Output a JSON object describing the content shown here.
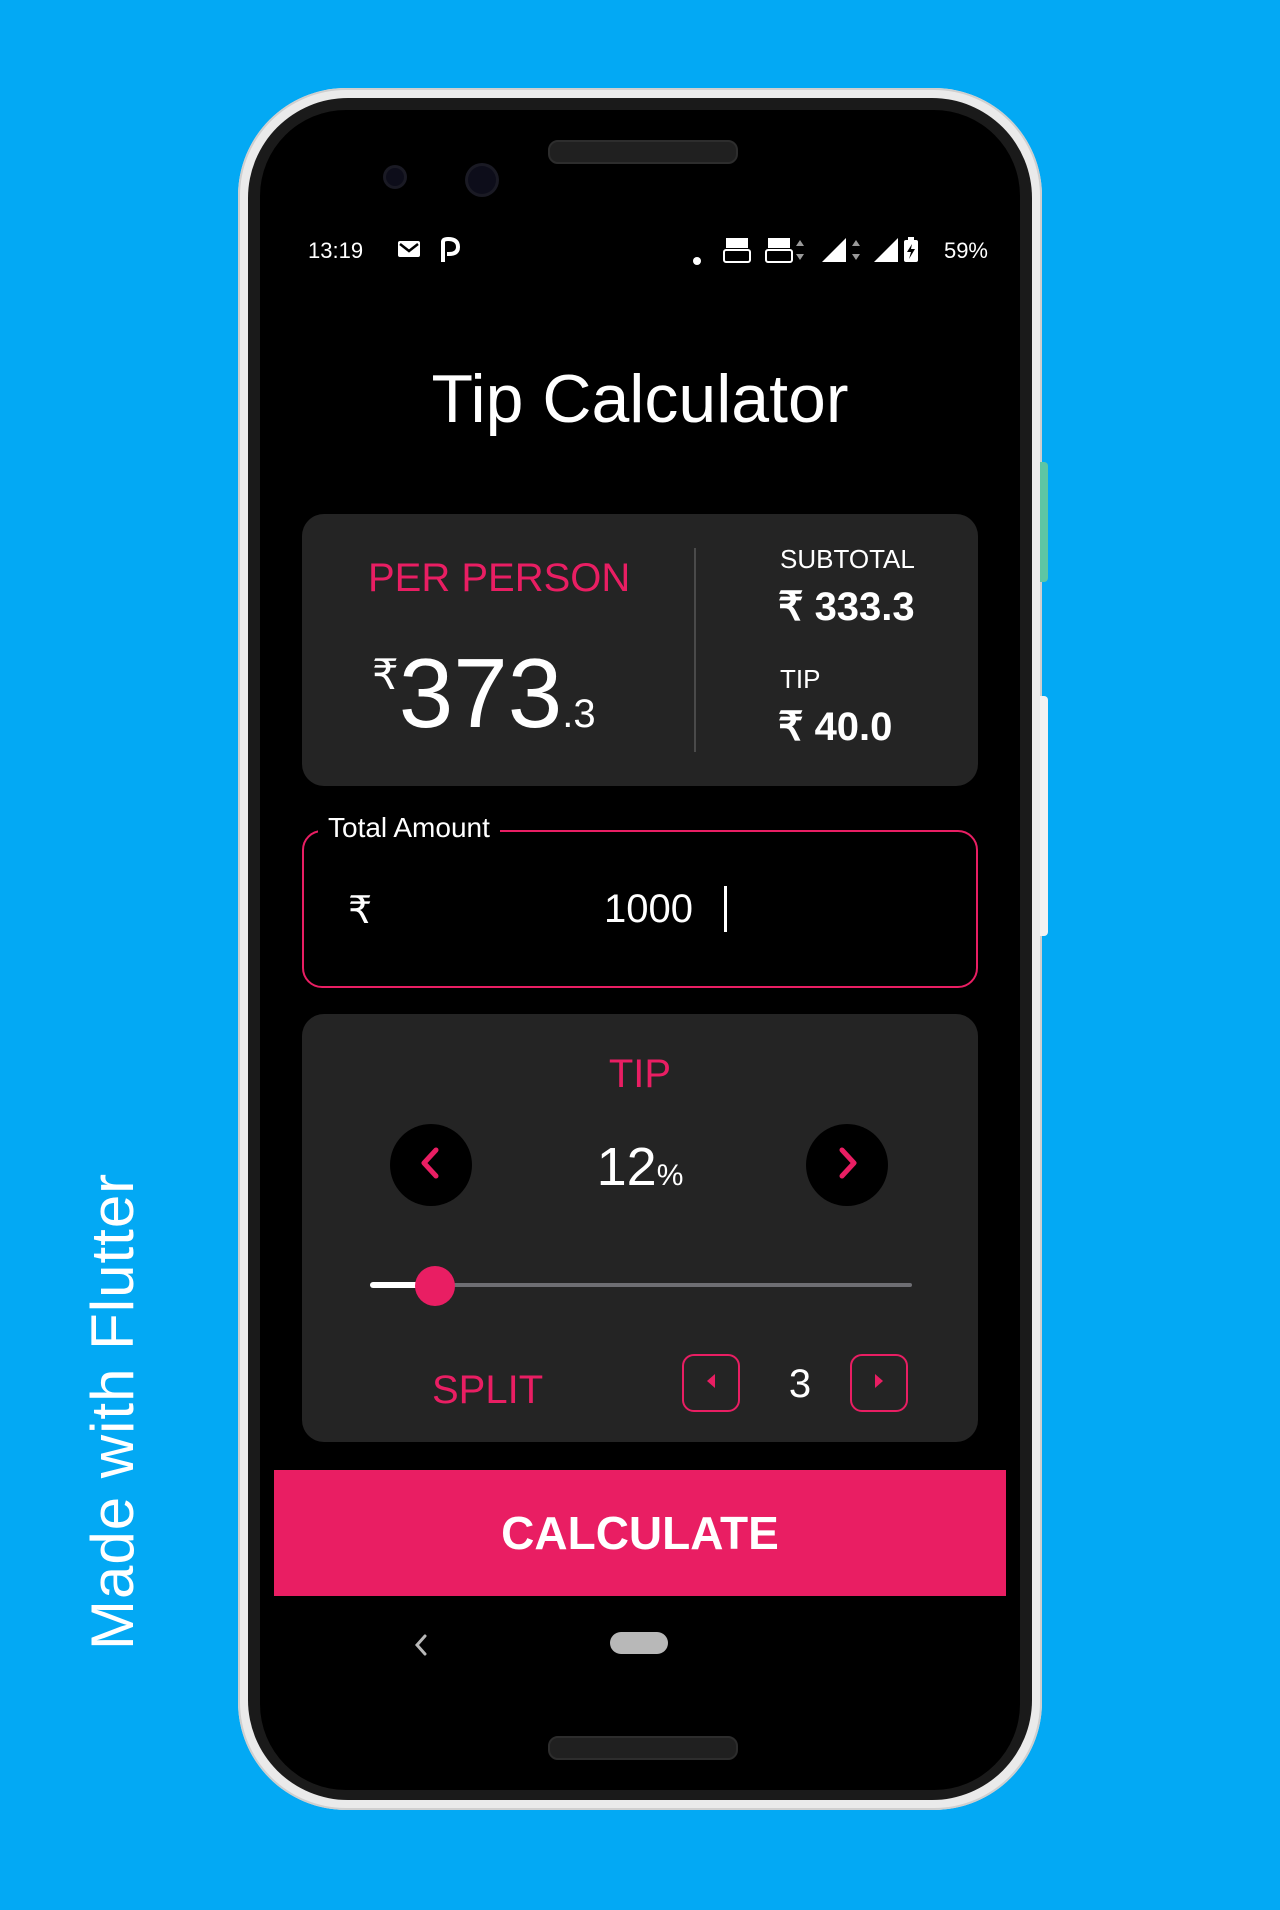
{
  "promo": {
    "side_text": "Made with Flutter"
  },
  "status_bar": {
    "time": "13:19",
    "left_icons": [
      "gmail-icon",
      "paytm-icon"
    ],
    "right_icons": [
      "notification-dot-icon",
      "volte1-icon",
      "volte2-icon",
      "signal1-icon",
      "signal2-icon",
      "battery-charging-icon"
    ],
    "battery": "59%"
  },
  "app": {
    "title": "Tip Calculator",
    "summary": {
      "per_person_label": "PER PERSON",
      "currency": "₹",
      "per_person_int": "373",
      "per_person_dec": ".3",
      "subtotal_label": "SUBTOTAL",
      "subtotal_value": "₹ 333.3",
      "tip_label": "TIP",
      "tip_value": "₹ 40.0"
    },
    "amount": {
      "label": "Total Amount",
      "currency": "₹",
      "value": "1000"
    },
    "tip": {
      "label": "TIP",
      "value": "12",
      "unit": "%",
      "slider_fraction": 0.12
    },
    "split": {
      "label": "SPLIT",
      "value": "3"
    },
    "calculate_label": "CALCULATE"
  },
  "colors": {
    "background": "#03a9f4",
    "accent": "#e91e63",
    "card": "#242424",
    "screen": "#000000"
  },
  "navigation": {
    "icons": [
      "back-chevron-icon",
      "home-pill-icon"
    ]
  }
}
